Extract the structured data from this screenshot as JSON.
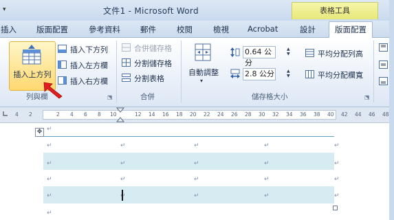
{
  "window": {
    "title": "文件1 - Microsoft Word",
    "context_tab": "表格工具"
  },
  "tabs": [
    "插入",
    "版面配置",
    "參考資料",
    "郵件",
    "校閱",
    "檢視",
    "Acrobat",
    "設計",
    "版面配置"
  ],
  "selected_tab_index": 8,
  "ribbon": {
    "rows_columns": {
      "insert_above": "插入上方列",
      "insert_below": "插入下方列",
      "insert_left": "插入左方欄",
      "insert_right": "插入右方欄",
      "group_label": "列與欄"
    },
    "merge": {
      "merge_cells": "合併儲存格",
      "split_cells": "分割儲存格",
      "split_table": "分割表格",
      "group_label": "合併"
    },
    "cell_size": {
      "autofit": "自動調整",
      "height_value": "0.64 公分",
      "width_value": "2.8 公分",
      "distribute_rows": "平均分配列高",
      "distribute_columns": "平均分配欄寬",
      "group_label": "儲存格大小"
    }
  },
  "ruler": {
    "numbers": [
      "4",
      "2",
      "2",
      "4",
      "6",
      "8",
      "10",
      "12",
      "14",
      "16",
      "18",
      "20",
      "22",
      "24",
      "26",
      "28",
      "30",
      "32",
      "34",
      "36",
      "38",
      "40",
      "42",
      "44",
      "46",
      "48"
    ]
  },
  "document": {
    "paragraph_mark": "↵",
    "table_move_icon": "move-icon"
  },
  "colors": {
    "shaded_row": "#d6ebf2",
    "context_tab": "#e6e87a",
    "selected_button": "#ffd870",
    "arrow": "#e02020"
  }
}
